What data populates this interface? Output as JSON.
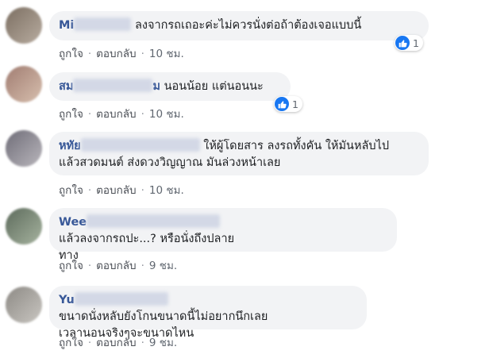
{
  "ui": {
    "like": "ถูกใจ",
    "reply": "ตอบกลับ",
    "sep": "·"
  },
  "comments": [
    {
      "author": "Mi",
      "lines": [
        "ลงจากรถเถอะค่ะไม่ควรนั่งต่อถ้าต้องเจอแบบนี้"
      ],
      "time": "10 ชม.",
      "reactions": "1",
      "avatar_colors": [
        "#7c6f62",
        "#b8aca0"
      ]
    },
    {
      "author": "สม",
      "author_suffix": "ม",
      "lines": [
        "นอนน้อย แต่นอนนะ"
      ],
      "time": "10 ชม.",
      "reactions": "1",
      "avatar_colors": [
        "#a17d72",
        "#d7bfae"
      ]
    },
    {
      "author": "หทัย",
      "lines": [
        "ให้ผู้โดยสาร ลงรถทั้งคัน ให้มันหลับไป",
        "แล้วสวดมนต์ ส่งดวงวิญญาณ มันล่วงหน้าเลย"
      ],
      "time": "10 ชม.",
      "avatar_colors": [
        "#6f6d78",
        "#b9b6bc"
      ]
    },
    {
      "author": "Wee",
      "lines": [
        "แล้วลงจากรถปะ...? หรือนั่งถึงปลาย",
        "ทาง"
      ],
      "time": "9 ชม.",
      "avatar_colors": [
        "#5d6b5c",
        "#a6b39f"
      ]
    },
    {
      "author": "Yu",
      "lines": [
        "ขนาดนั่งหลับยังโกนขนาดนี้ไม่อยากนึกเลย",
        "เวลานอนจริงๆจะขนาดไหน"
      ],
      "time": "9 ชม.",
      "avatar_colors": [
        "#8d8a85",
        "#c9c6c1"
      ]
    }
  ]
}
